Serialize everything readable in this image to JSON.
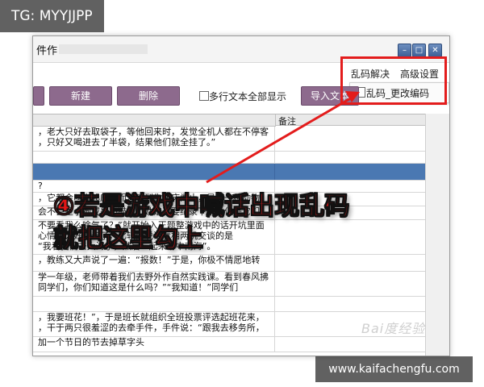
{
  "watermark_tag": "TG: MYYJJPP",
  "window": {
    "title": "件作",
    "controls": {
      "minimize": "–",
      "maximize": "□",
      "close": "✕"
    }
  },
  "menu": {
    "items": [
      "乱码解决",
      "高级设置"
    ],
    "dropdown_item": "乱码_更改编码"
  },
  "toolbar": {
    "new_label": "新建",
    "delete_label": "删除",
    "multiline_label": "多行文本全部显示",
    "import_label": "导入文本"
  },
  "grid": {
    "headers": [
      "",
      "备注"
    ],
    "rows": [
      {
        "text": "，老大只好去取袋子，等他回来时，发觉全机人都在不停客",
        "text2": "，只好又喝进去了半袋，结果他们就全挂了。”"
      },
      {
        "text": "",
        "text2": ""
      },
      {
        "text": "?",
        "text2": ""
      },
      {
        "text": "，它都会叫你起床，而且叫到你起床为止，是哪一种动物？",
        "text2": ""
      },
      {
        "text": "会不会是小狗或是小猫，小姑娘正要纪录下来，但是它们",
        "text2": ""
      },
      {
        "text": "不要看我么啥气了？”就开始入正题整游戏中的话开坑里面",
        "text2": "心情不太好也走了，比较少说话看相两机交谈的是",
        "text3": "“我看我们去大海了，然后一起来游中南海”。"
      },
      {
        "text": "，教练又大声说了一遍：“报数！”于是，你极不情愿地转",
        "text2": ""
      },
      {
        "text": "学一年级，老师带着我们去野外作自然实践课。看到春风拂",
        "text2": "同学们，你们知道这是什么吗？”“我知道！”同学们"
      },
      {
        "text": "",
        "text2": ""
      },
      {
        "text": "，我要班花！”，于是班长就组织全班投票评选起班花来，",
        "text2": "，干于两只很羞涩的去牵手件，手件说：“跟我去移务所，"
      },
      {
        "text": "加一个节日的节去掉草字头",
        "text2": ""
      }
    ]
  },
  "caption": {
    "line1": "④若是游戏中喊话出现乱码",
    "line2": "就把这里勾上"
  },
  "watermark_url": "www.kaifachengfu.com",
  "watermark_baidu": "Bai度经验",
  "colors": {
    "accent_red": "#e31c1c",
    "button_purple": "#8d6a8d",
    "selection_blue": "#4a78b2"
  }
}
